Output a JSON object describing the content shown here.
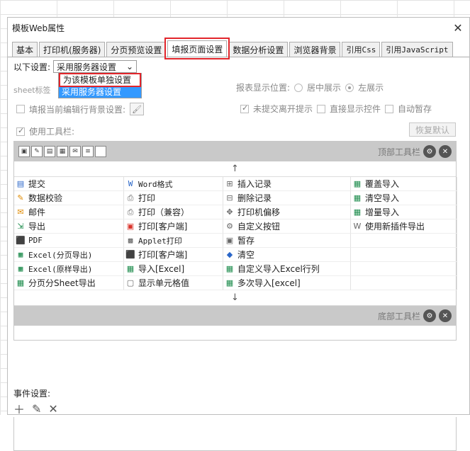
{
  "window": {
    "title": "模板Web属性",
    "close_glyph": "✕"
  },
  "tabs": [
    {
      "label": "基本"
    },
    {
      "label": "打印机(服务器)"
    },
    {
      "label": "分页预览设置"
    },
    {
      "label": "填报页面设置",
      "active": true
    },
    {
      "label": "数据分析设置"
    },
    {
      "label": "浏览器背景"
    },
    {
      "label": "引用Css"
    },
    {
      "label": "引用JavaScript"
    }
  ],
  "settings": {
    "label": "以下设置:",
    "selected": "采用服务器设置",
    "options": [
      "为该模板单独设置",
      "采用服务器设置"
    ],
    "sheet_label": "sheet标签",
    "report_pos_label": "报表显示位置:",
    "report_pos_center": "居中展示",
    "report_pos_left": "左展示",
    "bg_edit_label": "填报当前编辑行背景设置:",
    "unsubmitted_label": "未提交离开提示",
    "direct_control_label": "直接显示控件",
    "auto_save_label": "自动暂存",
    "use_toolbar_label": "使用工具栏:",
    "reset_label": "恢复默认"
  },
  "toolbar": {
    "top_label": "顶部工具栏",
    "bottom_label": "底部工具栏",
    "up_arrow": "↑",
    "down_arrow": "↓",
    "items": [
      [
        "提交",
        "Word格式",
        "插入记录",
        "覆盖导入"
      ],
      [
        "数据校验",
        "打印",
        "删除记录",
        "清空导入"
      ],
      [
        "邮件",
        "打印（兼容）",
        "打印机偏移",
        "增量导入"
      ],
      [
        "导出",
        "打印[客户端]",
        "自定义按钮",
        "使用新插件导出"
      ],
      [
        "PDF",
        "Applet打印",
        "暂存",
        ""
      ],
      [
        "Excel(分页导出)",
        "打印[客户端]",
        "清空",
        ""
      ],
      [
        "Excel(原样导出)",
        "导入[Excel]",
        "自定义导入Excel行列",
        ""
      ],
      [
        "分页分Sheet导出",
        "显示单元格值",
        "多次导入[excel]",
        ""
      ]
    ]
  },
  "events": {
    "label": "事件设置:"
  },
  "colors": {
    "highlight": "#e2252b",
    "selection": "#3399ff",
    "toolbar_bg": "#c9c9c9"
  }
}
